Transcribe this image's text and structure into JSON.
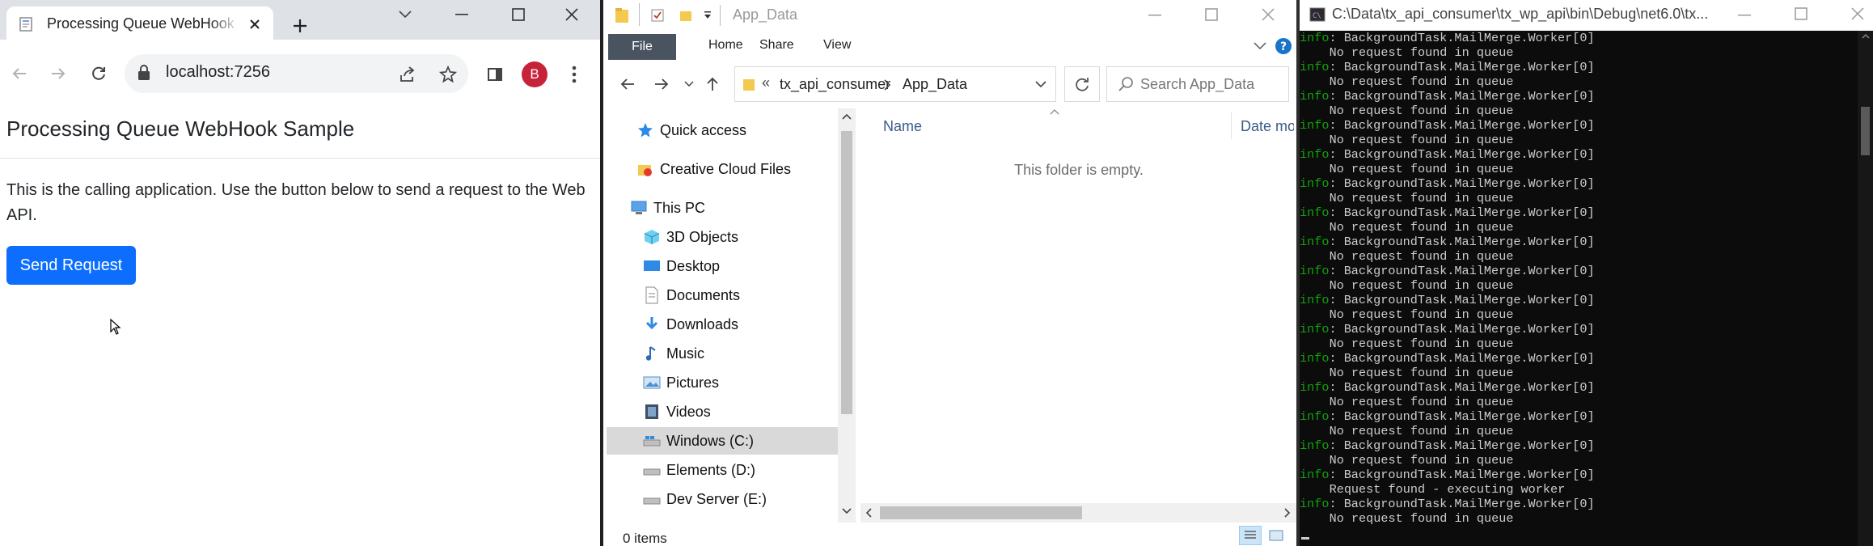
{
  "chrome": {
    "tab_title": "Processing Queue WebHook Sample",
    "url": "localhost:7256",
    "profile_initial": "B",
    "page": {
      "heading": "Processing Queue WebHook Sample",
      "description": "This is the calling application. Use the button below to send a request to the Web API.",
      "button_label": "Send Request"
    },
    "accent_color": "#0d6efd"
  },
  "explorer": {
    "title": "App_Data",
    "ribbon_tabs": [
      "File",
      "Home",
      "Share",
      "View"
    ],
    "breadcrumb": [
      "«",
      "tx_api_consumer",
      "App_Data"
    ],
    "search_placeholder": "Search App_Data",
    "nav_items": [
      {
        "label": "Quick access",
        "icon": "star-icon"
      },
      {
        "label": "Creative Cloud Files",
        "icon": "creative-cloud-icon"
      },
      {
        "label": "This PC",
        "icon": "computer-icon"
      },
      {
        "label": "3D Objects",
        "icon": "cube-icon"
      },
      {
        "label": "Desktop",
        "icon": "desktop-icon"
      },
      {
        "label": "Documents",
        "icon": "document-icon"
      },
      {
        "label": "Downloads",
        "icon": "download-icon"
      },
      {
        "label": "Music",
        "icon": "music-icon"
      },
      {
        "label": "Pictures",
        "icon": "picture-icon"
      },
      {
        "label": "Videos",
        "icon": "video-icon"
      },
      {
        "label": "Windows (C:)",
        "icon": "drive-icon"
      },
      {
        "label": "Elements (D:)",
        "icon": "drive-icon"
      },
      {
        "label": "Dev Server (E:)",
        "icon": "drive-icon"
      }
    ],
    "columns": [
      "Name",
      "Date mo"
    ],
    "empty_message": "This folder is empty.",
    "status": "0 items"
  },
  "console": {
    "title": "C:\\Data\\tx_api_consumer\\tx_wp_api\\bin\\Debug\\net6.0\\tx...",
    "log": [
      {
        "level": "info",
        "source": ": BackgroundTask.MailMerge.Worker[0]",
        "message": "No request found in queue"
      },
      {
        "level": "info",
        "source": ": BackgroundTask.MailMerge.Worker[0]",
        "message": "No request found in queue"
      },
      {
        "level": "info",
        "source": ": BackgroundTask.MailMerge.Worker[0]",
        "message": "No request found in queue"
      },
      {
        "level": "info",
        "source": ": BackgroundTask.MailMerge.Worker[0]",
        "message": "No request found in queue"
      },
      {
        "level": "info",
        "source": ": BackgroundTask.MailMerge.Worker[0]",
        "message": "No request found in queue"
      },
      {
        "level": "info",
        "source": ": BackgroundTask.MailMerge.Worker[0]",
        "message": "No request found in queue"
      },
      {
        "level": "info",
        "source": ": BackgroundTask.MailMerge.Worker[0]",
        "message": "No request found in queue"
      },
      {
        "level": "info",
        "source": ": BackgroundTask.MailMerge.Worker[0]",
        "message": "No request found in queue"
      },
      {
        "level": "info",
        "source": ": BackgroundTask.MailMerge.Worker[0]",
        "message": "No request found in queue"
      },
      {
        "level": "info",
        "source": ": BackgroundTask.MailMerge.Worker[0]",
        "message": "No request found in queue"
      },
      {
        "level": "info",
        "source": ": BackgroundTask.MailMerge.Worker[0]",
        "message": "No request found in queue"
      },
      {
        "level": "info",
        "source": ": BackgroundTask.MailMerge.Worker[0]",
        "message": "No request found in queue"
      },
      {
        "level": "info",
        "source": ": BackgroundTask.MailMerge.Worker[0]",
        "message": "No request found in queue"
      },
      {
        "level": "info",
        "source": ": BackgroundTask.MailMerge.Worker[0]",
        "message": "No request found in queue"
      },
      {
        "level": "info",
        "source": ": BackgroundTask.MailMerge.Worker[0]",
        "message": "No request found in queue"
      },
      {
        "level": "info",
        "source": ": BackgroundTask.MailMerge.Worker[0]",
        "message": "Request found - executing worker"
      },
      {
        "level": "info",
        "source": ": BackgroundTask.MailMerge.Worker[0]",
        "message": "No request found in queue"
      }
    ]
  }
}
